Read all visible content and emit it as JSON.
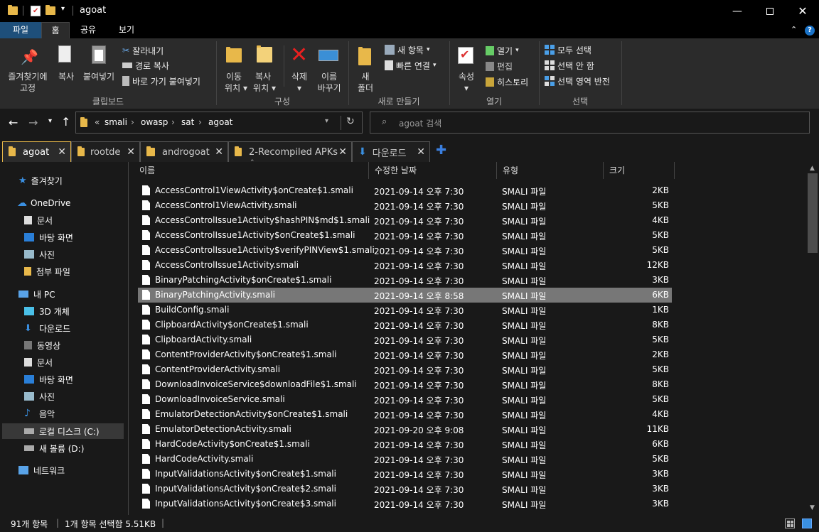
{
  "window": {
    "title": "agoat"
  },
  "ribbon_tabs": [
    "파일",
    "홈",
    "공유",
    "보기"
  ],
  "ribbon": {
    "pin_label_1": "즐겨찾기에",
    "pin_label_2": "고정",
    "copy": "복사",
    "paste": "붙여넣기",
    "cut": "잘라내기",
    "copy_path": "경로 복사",
    "paste_shortcut": "바로 가기 붙여넣기",
    "clipboard_group": "클립보드",
    "move_to_1": "이동",
    "move_to_2": "위치",
    "copy_to_1": "복사",
    "copy_to_2": "위치",
    "delete": "삭제",
    "rename_1": "이름",
    "rename_2": "바꾸기",
    "organize_group": "구성",
    "new_folder_1": "새",
    "new_folder_2": "폴더",
    "new_item": "새 항목",
    "easy_access": "빠른 연결",
    "new_group": "새로 만들기",
    "properties": "속성",
    "open": "열기",
    "edit": "편집",
    "history": "히스토리",
    "open_group": "열기",
    "select_all": "모두 선택",
    "select_none": "선택 안 함",
    "invert_selection": "선택 영역 반전",
    "select_group": "선택"
  },
  "address": {
    "crumbs": [
      "smali",
      "owasp",
      "sat",
      "agoat"
    ],
    "prefix": "«"
  },
  "search": {
    "placeholder": "agoat 검색"
  },
  "folder_tabs": [
    {
      "label": "agoat"
    },
    {
      "label": "rootde"
    },
    {
      "label": "androgoat"
    },
    {
      "label": "2-Recompiled APKs"
    },
    {
      "label": "다운로드"
    }
  ],
  "sidebar": {
    "quick_access": "즐겨찾기",
    "onedrive": "OneDrive",
    "od_items": [
      "문서",
      "바탕 화면",
      "사진",
      "첨부 파일"
    ],
    "this_pc": "내 PC",
    "pc_items": [
      "3D 개체",
      "다운로드",
      "동영상",
      "문서",
      "바탕 화면",
      "사진",
      "음악",
      "로컬 디스크 (C:)",
      "새 볼륨 (D:)"
    ],
    "network": "네트워크"
  },
  "columns": {
    "name": "이름",
    "modified": "수정한 날짜",
    "type": "유형",
    "size": "크기"
  },
  "files": [
    {
      "name": "AccessControl1ViewActivity$onCreate$1.smali",
      "date": "2021-09-14 오후 7:30",
      "type": "SMALI 파일",
      "size": "2KB"
    },
    {
      "name": "AccessControl1ViewActivity.smali",
      "date": "2021-09-14 오후 7:30",
      "type": "SMALI 파일",
      "size": "5KB"
    },
    {
      "name": "AccessControlIssue1Activity$hashPIN$md$1.smali",
      "date": "2021-09-14 오후 7:30",
      "type": "SMALI 파일",
      "size": "4KB"
    },
    {
      "name": "AccessControlIssue1Activity$onCreate$1.smali",
      "date": "2021-09-14 오후 7:30",
      "type": "SMALI 파일",
      "size": "5KB"
    },
    {
      "name": "AccessControlIssue1Activity$verifyPINView$1.smali",
      "date": "2021-09-14 오후 7:30",
      "type": "SMALI 파일",
      "size": "5KB"
    },
    {
      "name": "AccessControlIssue1Activity.smali",
      "date": "2021-09-14 오후 7:30",
      "type": "SMALI 파일",
      "size": "12KB"
    },
    {
      "name": "BinaryPatchingActivity$onCreate$1.smali",
      "date": "2021-09-14 오후 7:30",
      "type": "SMALI 파일",
      "size": "3KB"
    },
    {
      "name": "BinaryPatchingActivity.smali",
      "date": "2021-09-14 오후 8:58",
      "type": "SMALI 파일",
      "size": "6KB"
    },
    {
      "name": "BuildConfig.smali",
      "date": "2021-09-14 오후 7:30",
      "type": "SMALI 파일",
      "size": "1KB"
    },
    {
      "name": "ClipboardActivity$onCreate$1.smali",
      "date": "2021-09-14 오후 7:30",
      "type": "SMALI 파일",
      "size": "8KB"
    },
    {
      "name": "ClipboardActivity.smali",
      "date": "2021-09-14 오후 7:30",
      "type": "SMALI 파일",
      "size": "5KB"
    },
    {
      "name": "ContentProviderActivity$onCreate$1.smali",
      "date": "2021-09-14 오후 7:30",
      "type": "SMALI 파일",
      "size": "2KB"
    },
    {
      "name": "ContentProviderActivity.smali",
      "date": "2021-09-14 오후 7:30",
      "type": "SMALI 파일",
      "size": "5KB"
    },
    {
      "name": "DownloadInvoiceService$downloadFile$1.smali",
      "date": "2021-09-14 오후 7:30",
      "type": "SMALI 파일",
      "size": "8KB"
    },
    {
      "name": "DownloadInvoiceService.smali",
      "date": "2021-09-14 오후 7:30",
      "type": "SMALI 파일",
      "size": "5KB"
    },
    {
      "name": "EmulatorDetectionActivity$onCreate$1.smali",
      "date": "2021-09-14 오후 7:30",
      "type": "SMALI 파일",
      "size": "4KB"
    },
    {
      "name": "EmulatorDetectionActivity.smali",
      "date": "2021-09-20 오후 9:08",
      "type": "SMALI 파일",
      "size": "11KB"
    },
    {
      "name": "HardCodeActivity$onCreate$1.smali",
      "date": "2021-09-14 오후 7:30",
      "type": "SMALI 파일",
      "size": "6KB"
    },
    {
      "name": "HardCodeActivity.smali",
      "date": "2021-09-14 오후 7:30",
      "type": "SMALI 파일",
      "size": "5KB"
    },
    {
      "name": "InputValidationsActivity$onCreate$1.smali",
      "date": "2021-09-14 오후 7:30",
      "type": "SMALI 파일",
      "size": "3KB"
    },
    {
      "name": "InputValidationsActivity$onCreate$2.smali",
      "date": "2021-09-14 오후 7:30",
      "type": "SMALI 파일",
      "size": "3KB"
    },
    {
      "name": "InputValidationsActivity$onCreate$3.smali",
      "date": "2021-09-14 오후 7:30",
      "type": "SMALI 파일",
      "size": "3KB"
    }
  ],
  "selected_file": "BinaryPatchingActivity.smali",
  "status": {
    "count": "91개 항목",
    "selection": "1개 항목 선택함 5.51KB"
  },
  "colors": {
    "accent": "#e8b84a",
    "selected_tab": "#1e4f7a",
    "selection_row": "#777777"
  }
}
